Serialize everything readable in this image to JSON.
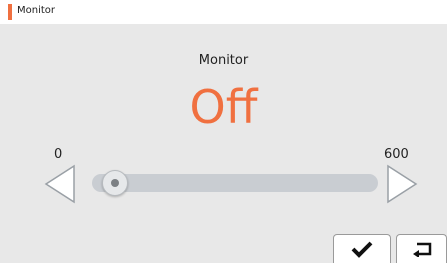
{
  "header": {
    "title": "Monitor"
  },
  "setting": {
    "name": "Monitor",
    "value": "Off",
    "min_label": "0",
    "max_label": "600",
    "level": 0.04
  },
  "colors": {
    "accent": "#f07040",
    "track": "#c9cdd2",
    "background": "#e8e8e8"
  },
  "icons": {
    "left": "left-arrow-icon",
    "right": "right-arrow-icon",
    "confirm": "checkmark-icon",
    "back": "return-icon"
  }
}
